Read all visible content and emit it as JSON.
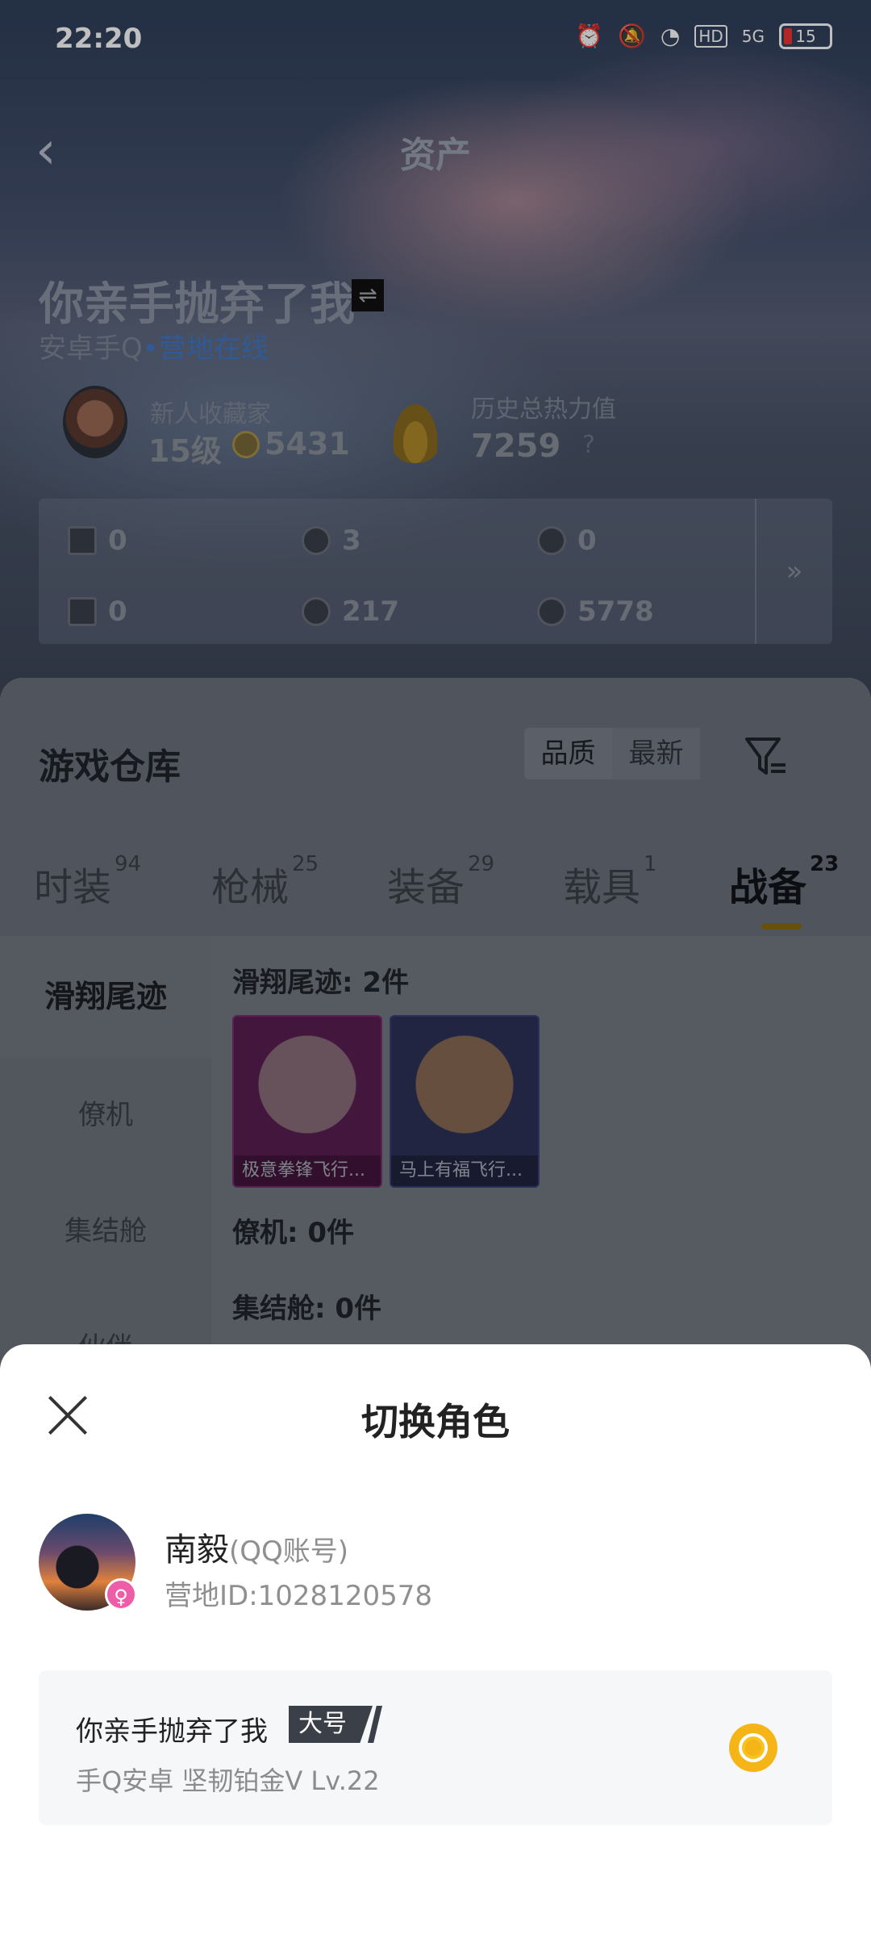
{
  "status": {
    "time": "22:20",
    "battery": "15",
    "network": "5G",
    "hd": "HD"
  },
  "nav": {
    "title": "资产"
  },
  "player": {
    "name": "你亲手抛弃了我",
    "platform": "安卓手Q",
    "online": "营地在线"
  },
  "collector": {
    "title": "新人收藏家",
    "level": "15级",
    "coins": "5431"
  },
  "heat": {
    "title": "历史总热力值",
    "value": "7259",
    "help": "?"
  },
  "stats": {
    "row1": [
      "0",
      "3",
      "0"
    ],
    "row2": [
      "0",
      "217",
      "5778"
    ],
    "more": "»"
  },
  "warehouse": {
    "title": "游戏仓库",
    "sort": [
      "品质",
      "最新"
    ],
    "tabs": [
      {
        "label": "时装",
        "count": "94"
      },
      {
        "label": "枪械",
        "count": "25"
      },
      {
        "label": "装备",
        "count": "29"
      },
      {
        "label": "载具",
        "count": "1"
      },
      {
        "label": "战备",
        "count": "23"
      }
    ],
    "side": [
      "滑翔尾迹",
      "僚机",
      "集结舱",
      "伙伴"
    ],
    "sections": [
      "滑翔尾迹: 2件",
      "僚机: 0件",
      "集结舱: 0件"
    ],
    "items": [
      "极意拳锋飞行...",
      "马上有福飞行..."
    ]
  },
  "sheet": {
    "title": "切换角色",
    "account_name": "南毅",
    "account_tag": "(QQ账号)",
    "account_id": "营地ID:1028120578",
    "role": {
      "name": "你亲手抛弃了我",
      "badge": "大号",
      "detail": "手Q安卓  坚韧铂金V  Lv.22"
    }
  },
  "colors": {
    "accent": "#f6b516",
    "online": "#3f78c8",
    "gender": "#ee5ea8"
  }
}
